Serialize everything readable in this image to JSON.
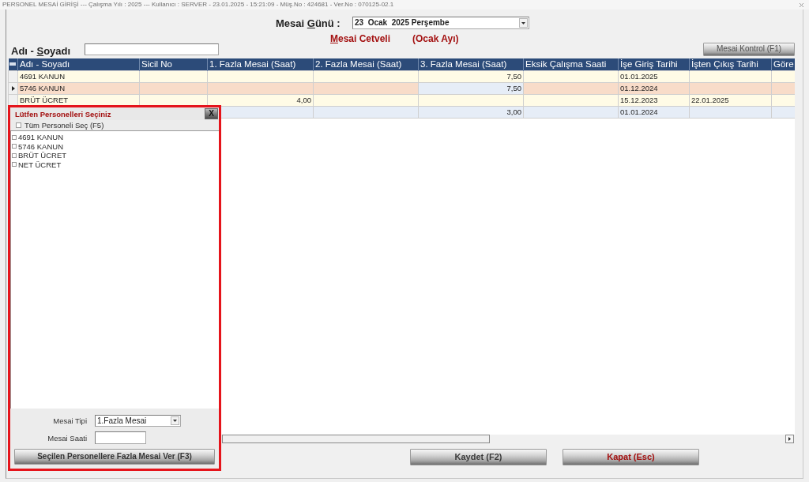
{
  "window": {
    "title": "PERSONEL MESAİ GİRİŞİ --- Çalışma Yılı : 2025 --- Kullanıcı : SERVER - 23.01.2025 - 15:21:09 - Müş.No : 424681 - Ver.No : 070125-02.1"
  },
  "date_field": {
    "label": [
      {
        "text": "Mesai ",
        "underlined": false
      },
      {
        "text": "G",
        "underlined": true
      },
      {
        "text": "ünü :",
        "underlined": false
      }
    ],
    "value": "23  Ocak  2025 Perşembe"
  },
  "sheet_title": [
    {
      "text": "M",
      "underlined": true
    },
    {
      "text": "esai Cetveli",
      "underlined": false
    }
  ],
  "period": "(Ocak Ayı)",
  "name_filter": {
    "label": [
      {
        "text": "Adı - ",
        "underlined": false
      },
      {
        "text": "S",
        "underlined": true
      },
      {
        "text": "oyadı",
        "underlined": false
      }
    ]
  },
  "check_button": {
    "label": "Mesai Kontrol (F1)"
  },
  "table": {
    "columns": [
      {
        "label": "Adı - Soyadı",
        "kind": "text",
        "current": false
      },
      {
        "label": "Sicil No",
        "kind": "text",
        "current": false
      },
      {
        "label": "1. Fazla Mesai (Saat)",
        "kind": "number",
        "current": false
      },
      {
        "label": "2. Fazla Mesai (Saat)",
        "kind": "number",
        "current": false
      },
      {
        "label": "3. Fazla Mesai (Saat)",
        "kind": "number",
        "current": true
      },
      {
        "label": "Eksik Çalışma Saati",
        "kind": "number",
        "current": false
      },
      {
        "label": "İşe Giriş Tarihi",
        "kind": "date",
        "current": false
      },
      {
        "label": "İşten Çıkış Tarihi",
        "kind": "date",
        "current": false
      },
      {
        "label": "Göre",
        "kind": "text",
        "current": false
      }
    ],
    "rows": [
      {
        "selected": false,
        "name": "4691 KANUN",
        "overtime_3": "7,50",
        "start_date": "01.01.2025"
      },
      {
        "selected": true,
        "name": "5746 KANUN",
        "overtime_3": "7,50",
        "start_date": "01.12.2024"
      },
      {
        "selected": false,
        "name": "BRÜT ÜCRET",
        "overtime_1": "4,00",
        "start_date": "15.12.2023",
        "end_date": "22.01.2025"
      },
      {
        "selected": false,
        "overtime_3": "3,00",
        "start_date": "01.01.2024"
      }
    ]
  },
  "popup": {
    "highlighted": true,
    "title": "Lütfen Personelleri Seçiniz",
    "close_label": "X",
    "select_all": {
      "label": "Tüm Personeli Seç (F5)",
      "checked": false
    },
    "items": [
      {
        "label": "4691 KANUN",
        "checked": false
      },
      {
        "label": "5746 KANUN",
        "checked": false
      },
      {
        "label": "BRÜT ÜCRET",
        "checked": false
      },
      {
        "label": "NET ÜCRET",
        "checked": false
      }
    ],
    "type_field": {
      "label": "Mesai Tipi",
      "value": "1.Fazla Mesai"
    },
    "hours_field": {
      "label": "Mesai Saati"
    },
    "apply_button": {
      "label": "Seçilen Personellere Fazla Mesai Ver (F3)"
    }
  },
  "buttons": [
    {
      "label": "Kaydet (F2)",
      "kind": "normal"
    },
    {
      "label": "Kapat (Esc)",
      "kind": "danger"
    }
  ]
}
